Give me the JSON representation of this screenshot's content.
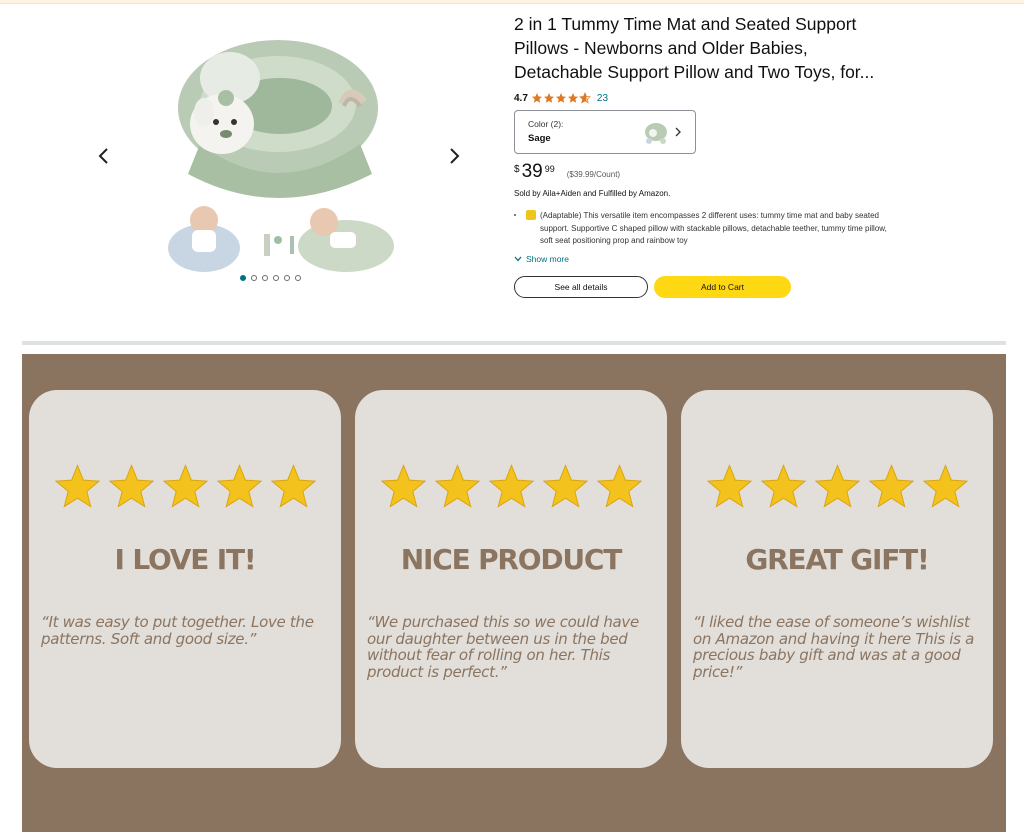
{
  "product": {
    "title": "2 in 1 Tummy Time Mat and Seated Support Pillows - Newborns and Older Babies, Detachable Support Pillow and Two Toys, for...",
    "rating_value": "4.7",
    "rating_stars": 4.7,
    "rating_count": "23",
    "color_label": "Color (2):",
    "color_value": "Sage",
    "price_symbol": "$",
    "price_whole": "39",
    "price_fraction": "99",
    "price_per_unit": "($39.99/Count)",
    "sold_by": "Sold by Aila+Aiden and Fulfilled by Amazon.",
    "bullet_text": "(Adaptable) This versatile item encompasses 2 different uses: tummy time mat and baby seated support. Supportive C shaped pillow with stackable pillows, detachable teether, tummy time pillow, soft seat positioning prop and rainbow toy",
    "show_more": "Show more",
    "see_all_details": "See all details",
    "add_to_cart": "Add to Cart"
  },
  "gallery": {
    "image_count": 6,
    "active_index": 0
  },
  "reviews": [
    {
      "stars": 5,
      "heading": "I LOVE IT!",
      "quote": "“It was easy to put together. Love the patterns. Soft and good size.”"
    },
    {
      "stars": 5,
      "heading": "NICE PRODUCT",
      "quote": "“We purchased this so we could have our daughter between us in the bed without fear of rolling on her. This product is perfect.”"
    },
    {
      "stars": 5,
      "heading": "GREAT GIFT!",
      "quote": "“I liked the ease of someone’s wishlist on Amazon and having it here This is a precious baby gift and was at a good price!”"
    }
  ],
  "colors": {
    "panel_bg": "#8a7460",
    "card_bg": "#e2ded9",
    "card_text": "#8b7560",
    "star_yellow": "#f4c21d",
    "link": "#007185",
    "cart_button": "#ffd814",
    "rating_star": "#de7921"
  },
  "icons": {
    "prev": "chevron-left-icon",
    "next": "chevron-right-icon",
    "review_star": "star-icon",
    "expand": "chevron-down-icon"
  }
}
